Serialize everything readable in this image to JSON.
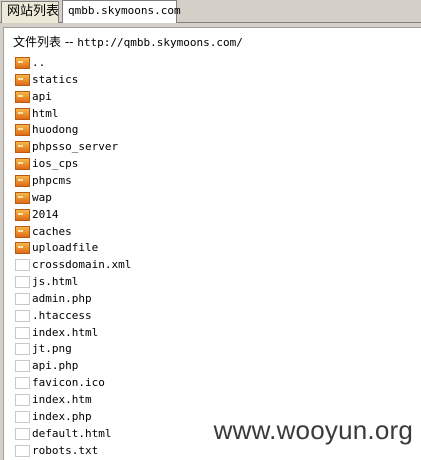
{
  "tabs": [
    {
      "label": "网站列表"
    },
    {
      "label": "qmbb.skymoons.com"
    }
  ],
  "panel": {
    "title_prefix": "文件列表 -- ",
    "title_url": "http://qmbb.skymoons.com/"
  },
  "entries": [
    {
      "name": "..",
      "type": "folder",
      "icon": "folder-icon"
    },
    {
      "name": "statics",
      "type": "folder",
      "icon": "folder-icon"
    },
    {
      "name": "api",
      "type": "folder",
      "icon": "folder-icon"
    },
    {
      "name": "html",
      "type": "folder",
      "icon": "folder-icon"
    },
    {
      "name": "huodong",
      "type": "folder",
      "icon": "folder-icon"
    },
    {
      "name": "phpsso_server",
      "type": "folder",
      "icon": "folder-icon"
    },
    {
      "name": "ios_cps",
      "type": "folder",
      "icon": "folder-icon"
    },
    {
      "name": "phpcms",
      "type": "folder",
      "icon": "folder-icon"
    },
    {
      "name": "wap",
      "type": "folder",
      "icon": "folder-icon"
    },
    {
      "name": "2014",
      "type": "folder",
      "icon": "folder-icon"
    },
    {
      "name": "caches",
      "type": "folder",
      "icon": "folder-icon"
    },
    {
      "name": "uploadfile",
      "type": "folder",
      "icon": "folder-icon"
    },
    {
      "name": "crossdomain.xml",
      "type": "file",
      "icon": "file-icon"
    },
    {
      "name": "js.html",
      "type": "file",
      "icon": "file-icon"
    },
    {
      "name": "admin.php",
      "type": "file",
      "icon": "file-icon"
    },
    {
      "name": ".htaccess",
      "type": "file",
      "icon": "file-icon"
    },
    {
      "name": "index.html",
      "type": "file",
      "icon": "file-icon"
    },
    {
      "name": "jt.png",
      "type": "file",
      "icon": "file-icon"
    },
    {
      "name": "api.php",
      "type": "file",
      "icon": "file-icon"
    },
    {
      "name": "favicon.ico",
      "type": "file",
      "icon": "file-icon"
    },
    {
      "name": "index.htm",
      "type": "file",
      "icon": "file-icon"
    },
    {
      "name": "index.php",
      "type": "file",
      "icon": "file-icon"
    },
    {
      "name": "default.html",
      "type": "file",
      "icon": "file-icon"
    },
    {
      "name": "robots.txt",
      "type": "file",
      "icon": "file-icon"
    }
  ],
  "watermark": "www.wooyun.org",
  "colors": {
    "folder": "#e06a18",
    "window_bg": "#d4d0c8",
    "panel_bg": "#ffffff"
  }
}
